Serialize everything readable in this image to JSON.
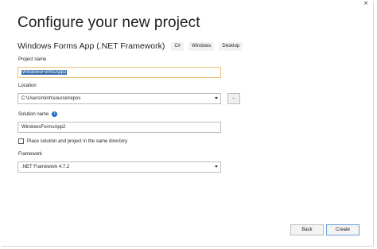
{
  "dialog": {
    "title": "Configure your new project",
    "close_glyph": "×"
  },
  "template": {
    "name": "Windows Forms App (.NET Framework)",
    "tags": [
      "C#",
      "Windows",
      "Desktop"
    ]
  },
  "project_name": {
    "label": "Project name",
    "value": "WindowsFormsApp2"
  },
  "location": {
    "label": "Location",
    "value": "C:\\Users\\minh\\source\\repos",
    "browse_label": "..."
  },
  "solution_name": {
    "label": "Solution name",
    "info_glyph": "i",
    "value": "WindowsFormsApp2"
  },
  "same_directory": {
    "label": "Place solution and project in the same directory",
    "checked": false
  },
  "framework": {
    "label": "Framework",
    "value": ".NET Framework 4.7.2"
  },
  "buttons": {
    "back": "Back",
    "create": "Create"
  },
  "colors": {
    "accent": "#1b6ac9",
    "focus_border": "#e8c07a",
    "selection": "#3a6ea8"
  },
  "icons": {
    "info": "info-icon",
    "dropdown": "chevron-down-icon",
    "close": "close-icon"
  }
}
